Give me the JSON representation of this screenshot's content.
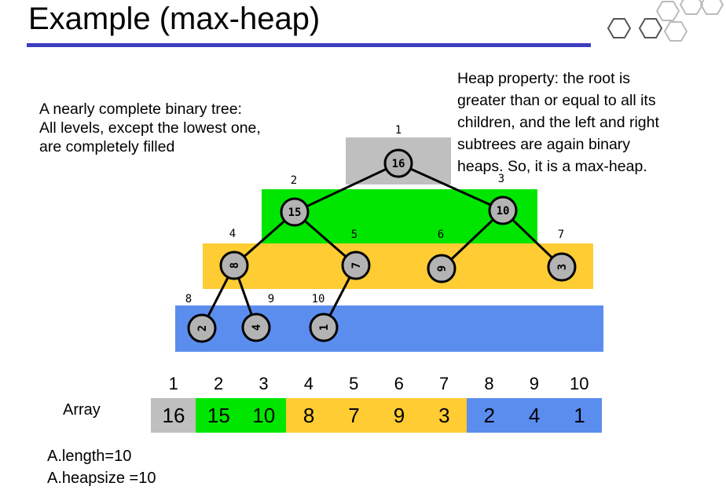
{
  "slide": {
    "title": "Example (max-heap)",
    "note_left": [
      "A nearly complete binary tree:",
      "All levels, except the lowest one,",
      "are completely filled"
    ],
    "note_right": [
      "Heap property: the root is",
      "greater than or equal to all its",
      "children, and the left and right",
      "subtrees are again binary",
      "heaps. So, it is a max-heap."
    ],
    "length_text": "A.length=10",
    "heapsize_text": "A.heapsize =10"
  },
  "colors": {
    "level0": "#bfbfbf",
    "level1": "#00e600",
    "level2": "#ffcc33",
    "level3": "#5b8def",
    "title_rule": "#3d3dbf",
    "node_fill": "#b3b3b3"
  },
  "tree": {
    "nodes": [
      {
        "pos": "1",
        "key": "16"
      },
      {
        "pos": "2",
        "key": "15"
      },
      {
        "pos": "3",
        "key": "10"
      },
      {
        "pos": "4",
        "key": "8"
      },
      {
        "pos": "5",
        "key": "7"
      },
      {
        "pos": "6",
        "key": "9"
      },
      {
        "pos": "7",
        "key": "3"
      },
      {
        "pos": "8",
        "key": "2"
      },
      {
        "pos": "9",
        "key": "4"
      },
      {
        "pos": "10",
        "key": "1"
      }
    ]
  },
  "array": {
    "label": "Array",
    "indices": [
      "1",
      "2",
      "3",
      "4",
      "5",
      "6",
      "7",
      "8",
      "9",
      "10"
    ],
    "values": [
      "16",
      "15",
      "10",
      "8",
      "7",
      "9",
      "3",
      "2",
      "4",
      "1"
    ],
    "levels": [
      0,
      1,
      1,
      2,
      2,
      2,
      2,
      3,
      3,
      3
    ]
  }
}
